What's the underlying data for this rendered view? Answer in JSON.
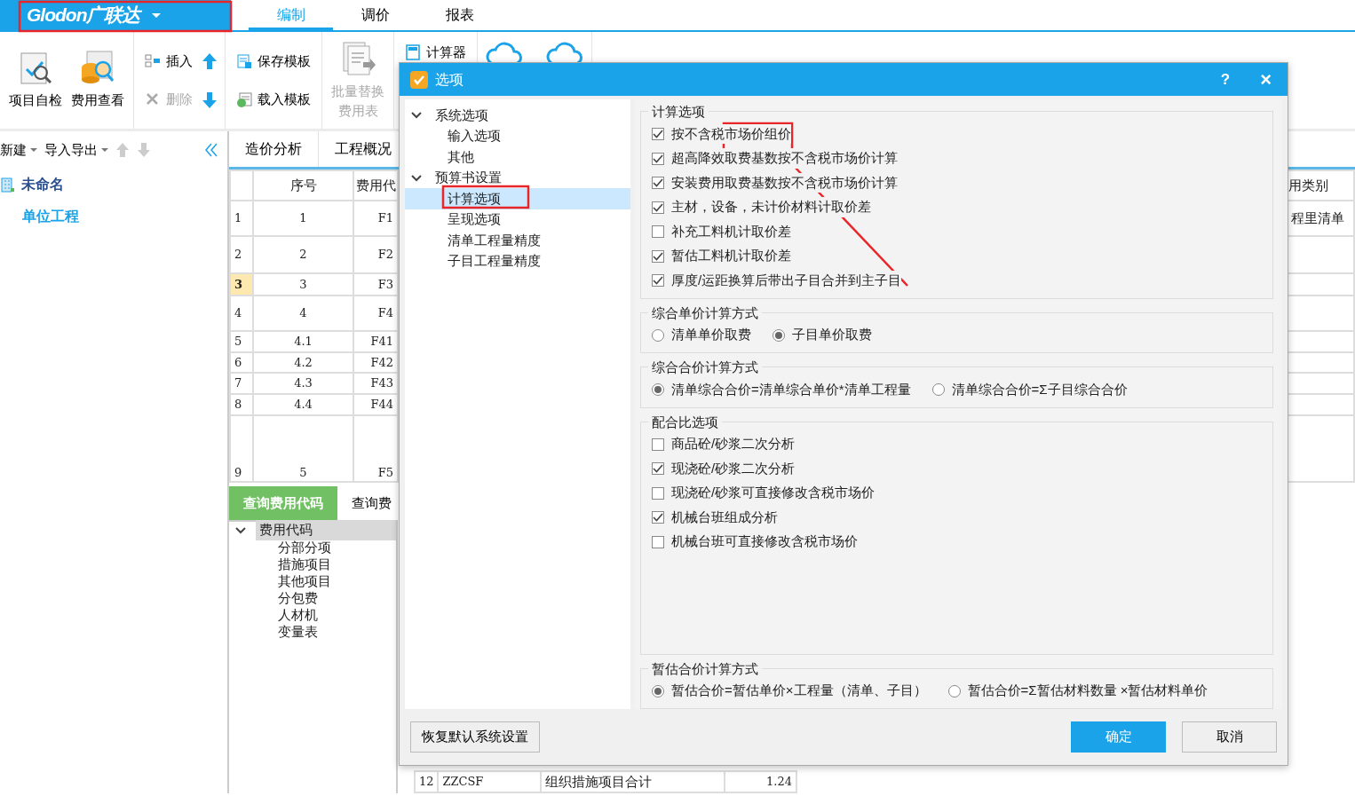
{
  "app": {
    "logo": "Glodon广联达",
    "tabs": [
      {
        "label": "编制",
        "selected": true
      },
      {
        "label": "调价",
        "selected": false
      },
      {
        "label": "报表",
        "selected": false
      }
    ]
  },
  "ribbon": [
    {
      "kind": "large",
      "label": "项目自检",
      "disabled": false
    },
    {
      "kind": "large",
      "label": "费用查看",
      "disabled": false
    },
    {
      "kind": "pair",
      "items": [
        {
          "label": "插入",
          "disabled": false
        },
        {
          "label": "删除",
          "disabled": true
        }
      ]
    },
    {
      "kind": "arrows"
    },
    {
      "kind": "pair",
      "items": [
        {
          "label": "保存模板",
          "disabled": false
        },
        {
          "label": "载入模板",
          "disabled": false
        }
      ]
    },
    {
      "kind": "large",
      "label": "批量替换费用表",
      "disabled": true
    },
    {
      "kind": "small",
      "label": "计算器"
    },
    {
      "kind": "cloud"
    },
    {
      "kind": "cloud"
    }
  ],
  "left_panel": {
    "toolbar": [
      {
        "label": "新建"
      },
      {
        "label": "导入导出"
      }
    ],
    "tree": [
      {
        "label": "未命名",
        "children": [
          {
            "label": "单位工程"
          }
        ]
      }
    ]
  },
  "main_tabs": [
    {
      "label": "造价分析",
      "selected": false
    },
    {
      "label": "工程概况",
      "selected": false
    }
  ],
  "table": {
    "columns": [
      "",
      "序号",
      "费用代",
      "用类别"
    ],
    "rows": [
      {
        "num": "1",
        "seq": "1",
        "code": "F1",
        "last": "程里清单",
        "selected": false
      },
      {
        "num": "2",
        "seq": "2",
        "code": "F2",
        "last": "",
        "selected": false
      },
      {
        "num": "3",
        "seq": "3",
        "code": "F3",
        "last": "",
        "selected": true
      },
      {
        "num": "4",
        "seq": "4",
        "code": "F4",
        "last": "",
        "selected": false
      },
      {
        "num": "5",
        "seq": "4.1",
        "code": "F41",
        "last": "",
        "selected": false
      },
      {
        "num": "6",
        "seq": "4.2",
        "code": "F42",
        "last": "",
        "selected": false
      },
      {
        "num": "7",
        "seq": "4.3",
        "code": "F43",
        "last": "",
        "selected": false
      },
      {
        "num": "8",
        "seq": "4.4",
        "code": "F44",
        "last": "",
        "selected": false
      },
      {
        "num": "9",
        "seq": "5",
        "code": "F5",
        "last": "",
        "selected": false
      }
    ]
  },
  "bottom_tabs": [
    {
      "label": "查询费用代码",
      "selected": true
    },
    {
      "label": "查询费",
      "selected": false
    }
  ],
  "code_tree": {
    "label": "费用代码",
    "expanded": true,
    "selected": true,
    "children": [
      {
        "label": "分部分项",
        "selected": false
      },
      {
        "label": "措施项目",
        "selected": false
      },
      {
        "label": "其他项目",
        "selected": false
      },
      {
        "label": "分包费",
        "selected": false
      },
      {
        "label": "人材机",
        "selected": false
      },
      {
        "label": "变量表",
        "selected": false
      }
    ]
  },
  "code_table": [
    {
      "num": "12",
      "code": "ZZCSF",
      "name": "组织措施项目合计",
      "rate": "1.24"
    }
  ],
  "dialog": {
    "title": "选项",
    "help": "?",
    "close": "×",
    "tree": [
      {
        "label": "系统选项",
        "expanded": true,
        "children": [
          {
            "label": "输入选项",
            "selected": false
          },
          {
            "label": "其他",
            "selected": false
          }
        ]
      },
      {
        "label": "预算书设置",
        "expanded": true,
        "children": [
          {
            "label": "计算选项",
            "selected": true
          },
          {
            "label": "呈现选项",
            "selected": false
          },
          {
            "label": "清单工程量精度",
            "selected": false
          },
          {
            "label": "子目工程量精度",
            "selected": false
          }
        ]
      }
    ],
    "groups": [
      {
        "title": "计算选项",
        "kind": "checks",
        "items": [
          {
            "label": "按不含税市场价组价",
            "checked": true
          },
          {
            "label": "超高降效取费基数按不含税市场价计算",
            "checked": true
          },
          {
            "label": "安装费用取费基数按不含税市场价计算",
            "checked": true
          },
          {
            "label": "主材，设备，未计价材料计取价差",
            "checked": true
          },
          {
            "label": "补充工料机计取价差",
            "checked": false
          },
          {
            "label": "暂估工料机计取价差",
            "checked": true
          },
          {
            "label": "厚度/运距换算后带出子目合并到主子目",
            "checked": true
          }
        ]
      },
      {
        "title": "综合单价计算方式",
        "kind": "radios",
        "items": [
          {
            "label": "清单单价取费",
            "selected": false
          },
          {
            "label": "子目单价取费",
            "selected": true
          }
        ]
      },
      {
        "title": "综合合价计算方式",
        "kind": "radios",
        "items": [
          {
            "label": "清单综合合价=清单综合单价*清单工程量",
            "selected": true
          },
          {
            "label": "清单综合合价=Σ子目综合合价",
            "selected": false
          }
        ]
      },
      {
        "title": "配合比选项",
        "kind": "checks",
        "items": [
          {
            "label": "商品砼/砂浆二次分析",
            "checked": false
          },
          {
            "label": "现浇砼/砂浆二次分析",
            "checked": true
          },
          {
            "label": "现浇砼/砂浆可直接修改含税市场价",
            "checked": false
          },
          {
            "label": "机械台班组成分析",
            "checked": true
          },
          {
            "label": "机械台班可直接修改含税市场价",
            "checked": false
          }
        ]
      },
      {
        "title": "暂估合价计算方式",
        "kind": "radios",
        "items": [
          {
            "label": "暂估合价=暂估单价×工程量（清单、子目）",
            "selected": true
          },
          {
            "label": "暂估合价=Σ暂估材料数量 ×暂估材料单价",
            "selected": false
          }
        ]
      }
    ],
    "buttons": [
      {
        "label": "恢复默认系统设置",
        "kind": "secondary"
      },
      {
        "label": "确定",
        "kind": "primary"
      },
      {
        "label": "取消",
        "kind": "secondary"
      }
    ]
  },
  "annotations": [
    {
      "kind": "box"
    },
    {
      "kind": "box"
    },
    {
      "kind": "box"
    },
    {
      "kind": "arrow"
    }
  ]
}
